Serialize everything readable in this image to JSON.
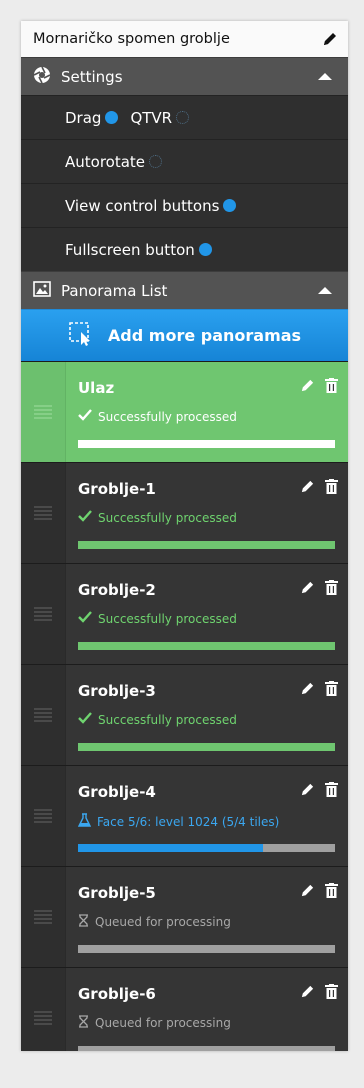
{
  "title": "Mornaričko spomen groblje",
  "settings": {
    "header": "Settings",
    "rows": [
      {
        "items": [
          {
            "label": "Drag",
            "state": "on"
          },
          {
            "label": "QTVR",
            "state": "off"
          }
        ]
      },
      {
        "items": [
          {
            "label": "Autorotate",
            "state": "off"
          }
        ]
      },
      {
        "items": [
          {
            "label": "View control buttons",
            "state": "on"
          }
        ]
      },
      {
        "items": [
          {
            "label": "Fullscreen button",
            "state": "on"
          }
        ]
      }
    ]
  },
  "panorama_list": {
    "header": "Panorama List",
    "add_label": "Add more panoramas",
    "items": [
      {
        "name": "Ulaz",
        "status": "Successfully processed",
        "kind": "ok",
        "progress": 1.0,
        "active": true
      },
      {
        "name": "Groblje-1",
        "status": "Successfully processed",
        "kind": "ok",
        "progress": 1.0
      },
      {
        "name": "Groblje-2",
        "status": "Successfully processed",
        "kind": "ok",
        "progress": 1.0
      },
      {
        "name": "Groblje-3",
        "status": "Successfully processed",
        "kind": "ok",
        "progress": 1.0
      },
      {
        "name": "Groblje-4",
        "status": "Face 5/6: level 1024 (5/4 tiles)",
        "kind": "progress",
        "progress": 0.72
      },
      {
        "name": "Groblje-5",
        "status": "Queued for processing",
        "kind": "queued",
        "progress": 0
      },
      {
        "name": "Groblje-6",
        "status": "Queued for processing",
        "kind": "queued",
        "progress": 0
      }
    ]
  },
  "colors": {
    "accent": "#2196e8",
    "success": "#6fc670",
    "progress": "#2196e8",
    "track": "#a0a0a0"
  },
  "icons": {
    "title_edit": "pencil-icon",
    "settings": "aperture-icon",
    "panorama_list": "image-icon",
    "add": "add-selection-icon",
    "edit": "pencil-icon",
    "delete": "trash-icon",
    "ok": "check-icon",
    "progress": "flask-icon",
    "queued": "hourglass-icon",
    "drag": "grip-icon"
  }
}
